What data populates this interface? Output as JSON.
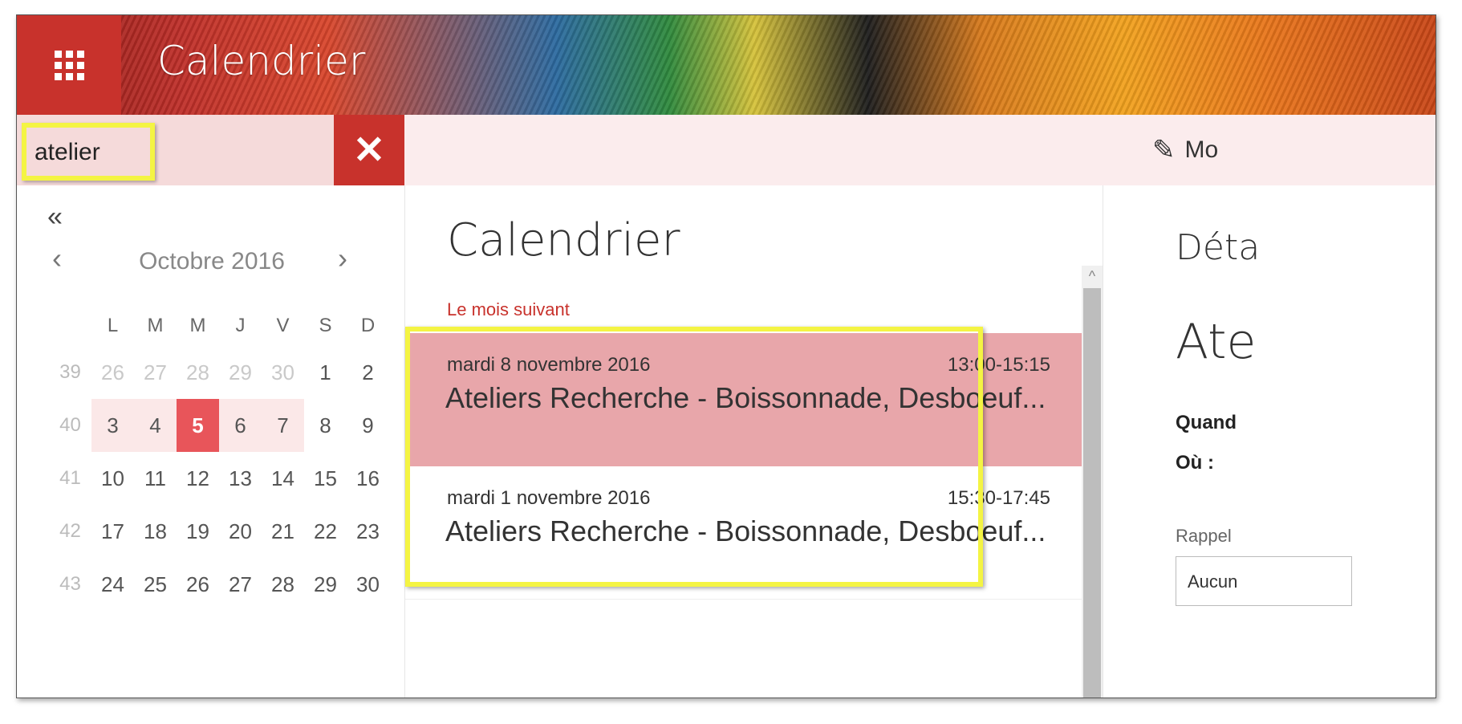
{
  "app": {
    "title": "Calendrier"
  },
  "search": {
    "value": "atelier"
  },
  "toolbar": {
    "edit_label": "Mo"
  },
  "mini_calendar": {
    "collapse": "«",
    "prev": "‹",
    "next": "›",
    "month_label": "Octobre 2016",
    "day_headers": [
      "L",
      "M",
      "M",
      "J",
      "V",
      "S",
      "D"
    ],
    "weeks": [
      {
        "num": "39",
        "days": [
          "26",
          "27",
          "28",
          "29",
          "30",
          "1",
          "2"
        ]
      },
      {
        "num": "40",
        "days": [
          "3",
          "4",
          "5",
          "6",
          "7",
          "8",
          "9"
        ]
      },
      {
        "num": "41",
        "days": [
          "10",
          "11",
          "12",
          "13",
          "14",
          "15",
          "16"
        ]
      },
      {
        "num": "42",
        "days": [
          "17",
          "18",
          "19",
          "20",
          "21",
          "22",
          "23"
        ]
      },
      {
        "num": "43",
        "days": [
          "24",
          "25",
          "26",
          "27",
          "28",
          "29",
          "30"
        ]
      }
    ],
    "today": "5"
  },
  "list": {
    "title": "Calendrier",
    "section": "Le mois suivant",
    "events": [
      {
        "date": "mardi 8 novembre 2016",
        "time": "13:00-15:15",
        "title": "Ateliers Recherche - Boissonnade, Desboeuf..."
      },
      {
        "date": "mardi 1 novembre 2016",
        "time": "15:30-17:45",
        "title": "Ateliers Recherche - Boissonnade, Desboeuf..."
      }
    ],
    "scroll_up": "^"
  },
  "details": {
    "title": "Déta",
    "event_name": "Ate",
    "when_label": "Quand",
    "where_label": "Où :",
    "reminder_label": "Rappel",
    "reminder_value": "Aucun"
  },
  "colors": {
    "accent": "#c8322c",
    "selected_event": "#e8a6aa",
    "highlight": "#f4f443",
    "today": "#e8555a"
  }
}
